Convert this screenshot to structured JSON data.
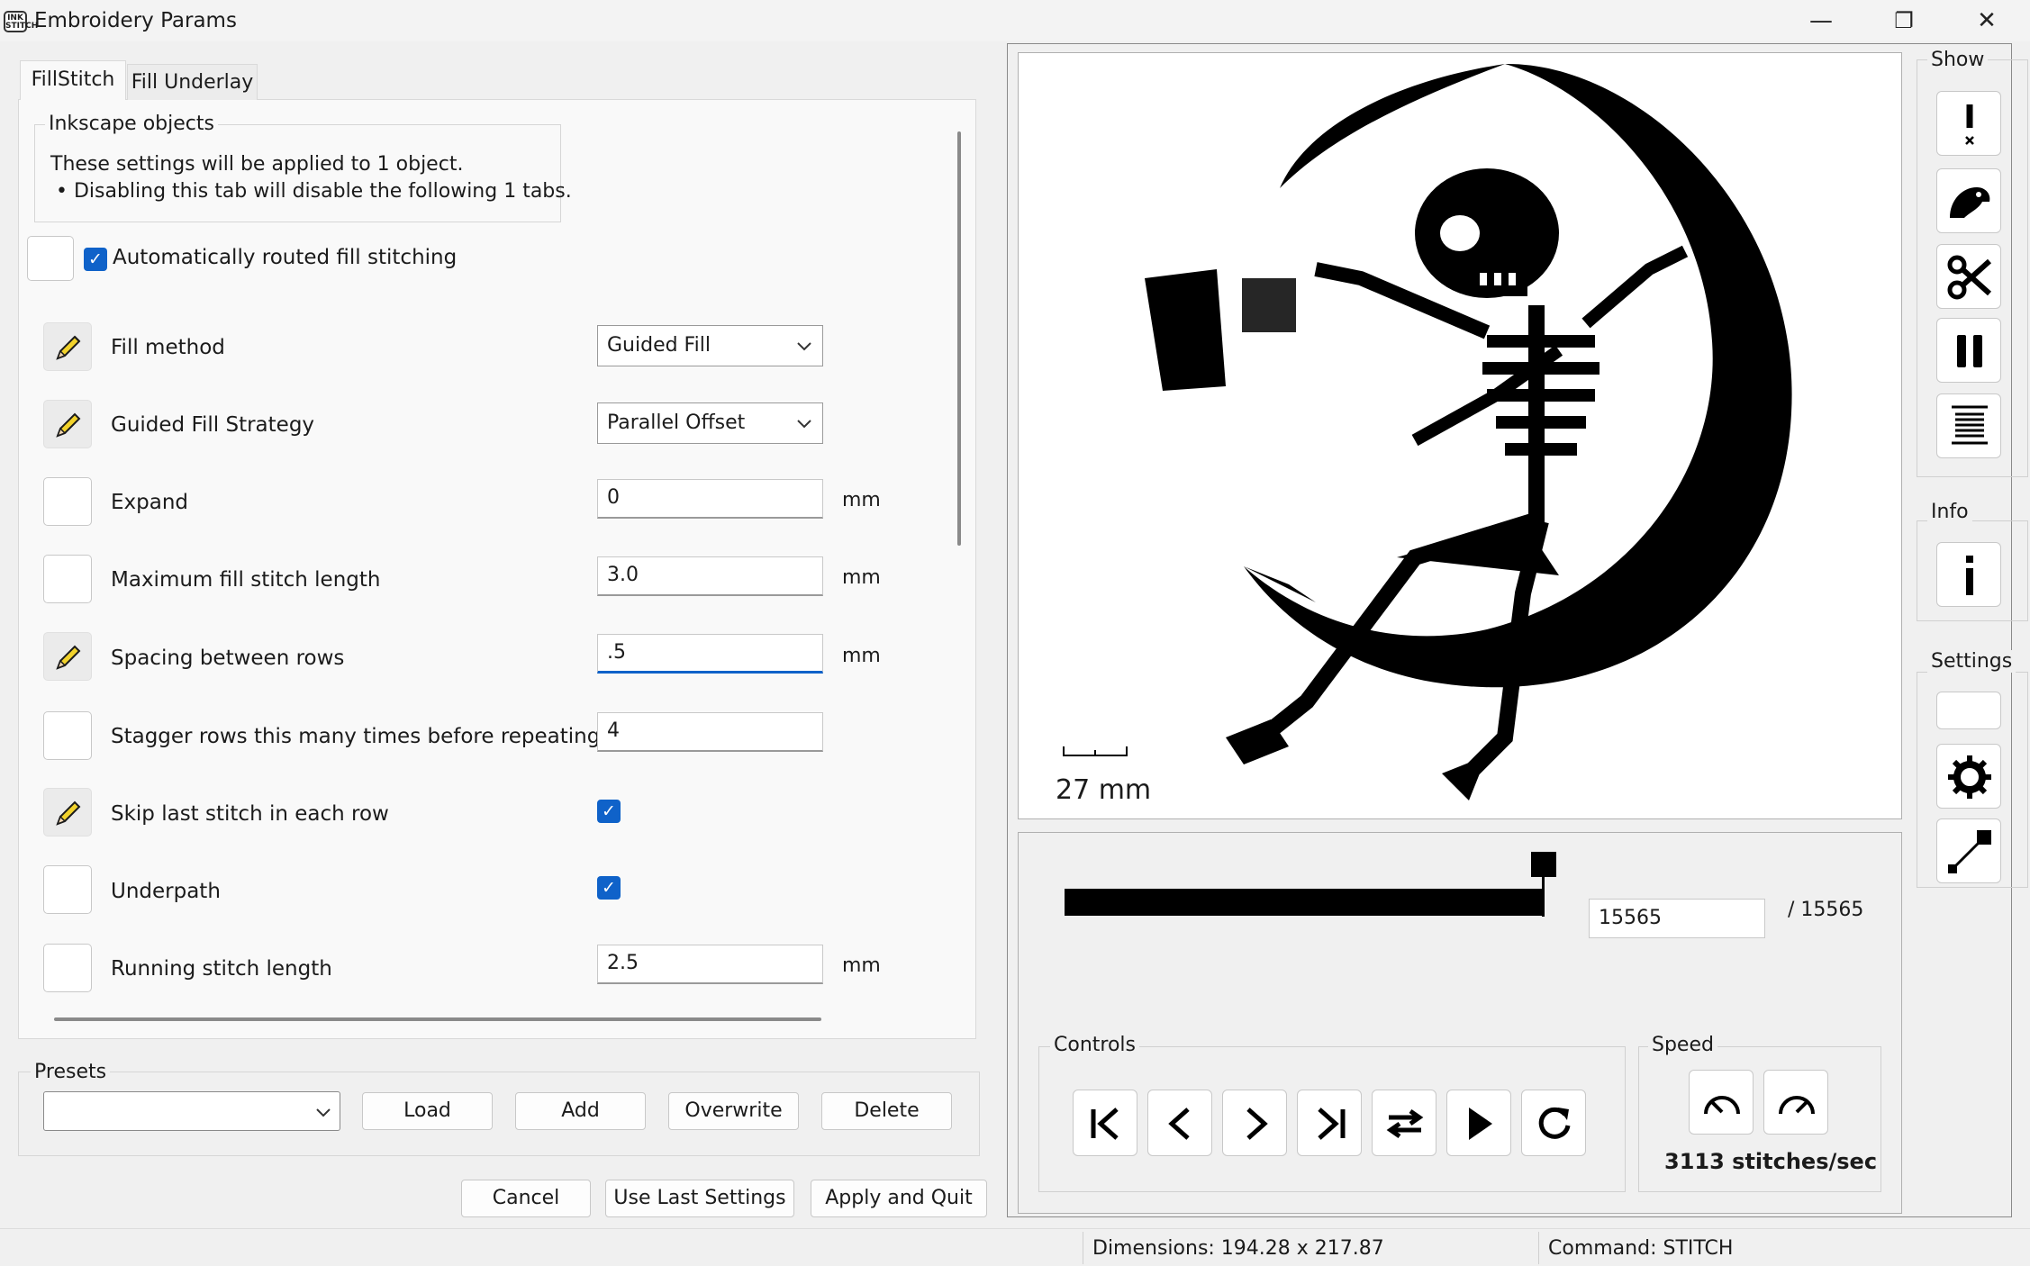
{
  "window": {
    "title": "Embroidery Params",
    "app_icon_text": "INK STITCH",
    "minimize": "—",
    "restore": "❐",
    "close": "✕"
  },
  "tabs": [
    {
      "label": "FillStitch",
      "active": true
    },
    {
      "label": "Fill Underlay",
      "active": false
    }
  ],
  "inkscape_objects": {
    "title": "Inkscape objects",
    "line1": "These settings will be applied to 1 object.",
    "line2": "• Disabling this tab will disable the following 1 tabs."
  },
  "auto_routed": {
    "label": "Automatically routed fill stitching",
    "checked": true
  },
  "params": [
    {
      "label": "Fill method",
      "type": "select",
      "value": "Guided Fill",
      "unit": "",
      "edited": true
    },
    {
      "label": "Guided Fill Strategy",
      "type": "select",
      "value": "Parallel Offset",
      "unit": "",
      "edited": true
    },
    {
      "label": "Expand",
      "type": "text",
      "value": "0",
      "unit": "mm",
      "edited": false
    },
    {
      "label": "Maximum fill stitch length",
      "type": "text",
      "value": "3.0",
      "unit": "mm",
      "edited": false
    },
    {
      "label": "Spacing between rows",
      "type": "text",
      "value": ".5",
      "unit": "mm",
      "edited": true
    },
    {
      "label": "Stagger rows this many times before repeating",
      "type": "text",
      "value": "4",
      "unit": "",
      "edited": false
    },
    {
      "label": "Skip last stitch in each row",
      "type": "checkbox",
      "checked": true,
      "edited": true
    },
    {
      "label": "Underpath",
      "type": "checkbox",
      "checked": true,
      "edited": false
    },
    {
      "label": "Running stitch length",
      "type": "text",
      "value": "2.5",
      "unit": "mm",
      "edited": false
    }
  ],
  "presets": {
    "title": "Presets",
    "selected": "",
    "buttons": [
      "Load",
      "Add",
      "Overwrite",
      "Delete"
    ]
  },
  "footer_buttons": [
    "Cancel",
    "Use Last Settings",
    "Apply and Quit"
  ],
  "preview": {
    "scale_label": "27 mm",
    "current_stitch": "15565",
    "total_stitches": "/ 15565",
    "progress": 1.0,
    "controls_title": "Controls",
    "speed_title": "Speed",
    "speed_text": "3113 stitches/sec"
  },
  "side": {
    "show_title": "Show",
    "info_title": "Info",
    "settings_title": "Settings"
  },
  "status": {
    "dimensions": "Dimensions: 194.28 x 217.87",
    "command": "Command: STITCH"
  },
  "colors": {
    "accent": "#0f62c9",
    "stitch": "#000000"
  }
}
